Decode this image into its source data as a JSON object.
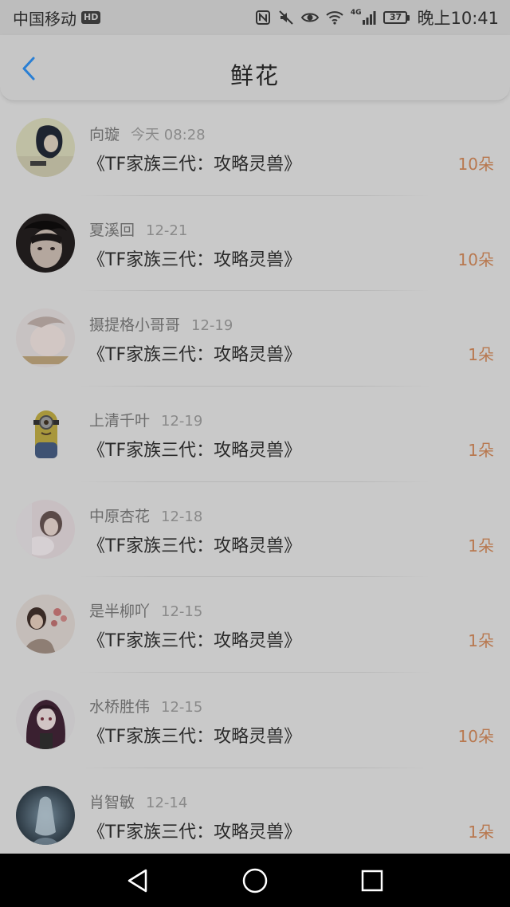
{
  "status_bar": {
    "carrier": "中国移动",
    "hd_badge": "HD",
    "signal_label": "4G",
    "battery_level": "37",
    "time": "晚上10:41"
  },
  "nav": {
    "title": "鲜花",
    "back_icon": "chevron-left-icon"
  },
  "colors": {
    "accent_blue": "#2a7fd4",
    "count_orange": "#b8784f"
  },
  "items": [
    {
      "name": "向璇",
      "time": "今天 08:28",
      "book": "《TF家族三代：攻略灵兽》",
      "count": "10朵",
      "avatar": "avatar-girl-dark-hair"
    },
    {
      "name": "夏溪回",
      "time": "12-21",
      "book": "《TF家族三代：攻略灵兽》",
      "count": "10朵",
      "avatar": "avatar-boy-face"
    },
    {
      "name": "摄提格小哥哥",
      "time": "12-19",
      "book": "《TF家族三代：攻略灵兽》",
      "count": "1朵",
      "avatar": "avatar-blurred-face"
    },
    {
      "name": "上清千叶",
      "time": "12-19",
      "book": "《TF家族三代：攻略灵兽》",
      "count": "1朵",
      "avatar": "avatar-minion"
    },
    {
      "name": "中原杏花",
      "time": "12-18",
      "book": "《TF家族三代：攻略灵兽》",
      "count": "1朵",
      "avatar": "avatar-girl-light"
    },
    {
      "name": "是半柳吖",
      "time": "12-15",
      "book": "《TF家族三代：攻略灵兽》",
      "count": "1朵",
      "avatar": "avatar-girl-flowers"
    },
    {
      "name": "水桥胜伟",
      "time": "12-15",
      "book": "《TF家族三代：攻略灵兽》",
      "count": "10朵",
      "avatar": "avatar-anime-girl"
    },
    {
      "name": "肖智敏",
      "time": "12-14",
      "book": "《TF家族三代：攻略灵兽》",
      "count": "1朵",
      "avatar": "avatar-blue-ghost"
    }
  ],
  "system_nav": {
    "back_icon": "triangle-back-icon",
    "home_icon": "circle-home-icon",
    "recents_icon": "square-recents-icon"
  }
}
